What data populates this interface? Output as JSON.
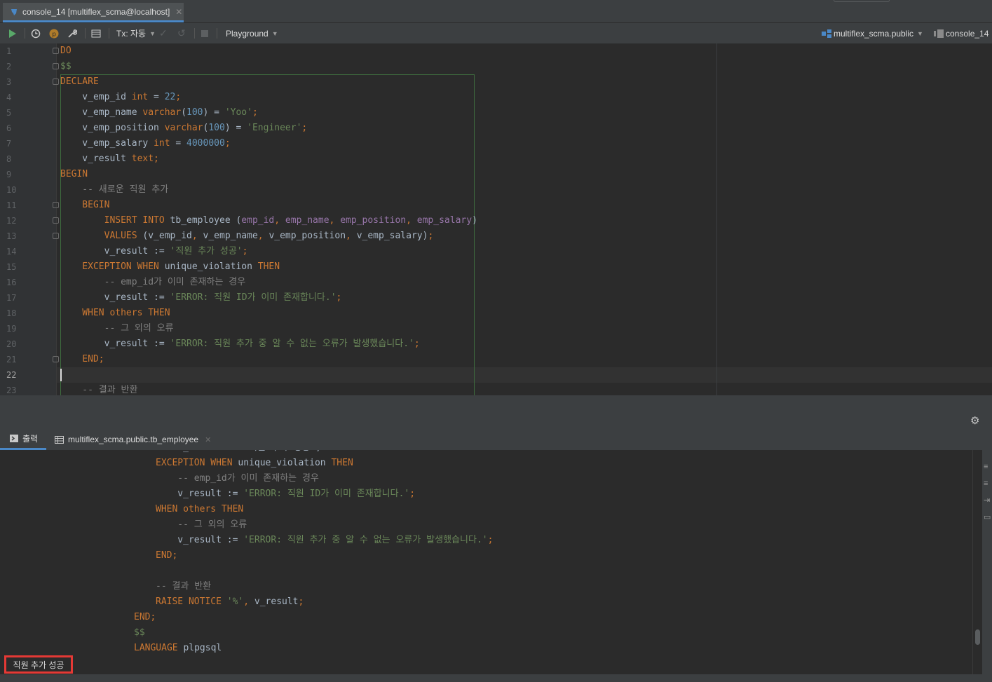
{
  "tab": {
    "title": "console_14 [multiflex_scma@localhost]"
  },
  "toolbar": {
    "tx_label": "Tx: 자동",
    "playground_label": "Playground",
    "schema_label": "multiflex_scma.public",
    "console_label": "console_14"
  },
  "editor": {
    "line_numbers": [
      "1",
      "2",
      "3",
      "4",
      "5",
      "6",
      "7",
      "8",
      "9",
      "10",
      "11",
      "12",
      "13",
      "14",
      "15",
      "16",
      "17",
      "18",
      "19",
      "20",
      "21",
      "22",
      "23"
    ],
    "current_line": "22",
    "lines": [
      [
        {
          "t": "DO",
          "c": "kw"
        }
      ],
      [
        {
          "t": "$$",
          "c": "str"
        }
      ],
      [
        {
          "t": "DECLARE",
          "c": "kw"
        }
      ],
      [
        {
          "t": "    v_emp_id ",
          "c": "id"
        },
        {
          "t": "int",
          "c": "kw"
        },
        {
          "t": " = ",
          "c": "id"
        },
        {
          "t": "22",
          "c": "num"
        },
        {
          "t": ";",
          "c": "kw"
        }
      ],
      [
        {
          "t": "    v_emp_name ",
          "c": "id"
        },
        {
          "t": "varchar",
          "c": "kw"
        },
        {
          "t": "(",
          "c": "id"
        },
        {
          "t": "100",
          "c": "num"
        },
        {
          "t": ") = ",
          "c": "id"
        },
        {
          "t": "'Yoo'",
          "c": "str"
        },
        {
          "t": ";",
          "c": "kw"
        }
      ],
      [
        {
          "t": "    v_emp_position ",
          "c": "id"
        },
        {
          "t": "varchar",
          "c": "kw"
        },
        {
          "t": "(",
          "c": "id"
        },
        {
          "t": "100",
          "c": "num"
        },
        {
          "t": ") = ",
          "c": "id"
        },
        {
          "t": "'Engineer'",
          "c": "str"
        },
        {
          "t": ";",
          "c": "kw"
        }
      ],
      [
        {
          "t": "    v_emp_salary ",
          "c": "id"
        },
        {
          "t": "int",
          "c": "kw"
        },
        {
          "t": " = ",
          "c": "id"
        },
        {
          "t": "4000000",
          "c": "num"
        },
        {
          "t": ";",
          "c": "kw"
        }
      ],
      [
        {
          "t": "    v_result ",
          "c": "id"
        },
        {
          "t": "text;",
          "c": "kw"
        }
      ],
      [
        {
          "t": "BEGIN",
          "c": "kw"
        }
      ],
      [
        {
          "t": "    -- 새로운 직원 추가",
          "c": "cmt"
        }
      ],
      [
        {
          "t": "    BEGIN",
          "c": "kw"
        }
      ],
      [
        {
          "t": "        INSERT INTO ",
          "c": "kw"
        },
        {
          "t": "tb_employee (",
          "c": "id"
        },
        {
          "t": "emp_id",
          "c": "col"
        },
        {
          "t": ", ",
          "c": "kw"
        },
        {
          "t": "emp_name",
          "c": "col"
        },
        {
          "t": ", ",
          "c": "kw"
        },
        {
          "t": "emp_position",
          "c": "col"
        },
        {
          "t": ", ",
          "c": "kw"
        },
        {
          "t": "emp_salary",
          "c": "col"
        },
        {
          "t": ")",
          "c": "id"
        }
      ],
      [
        {
          "t": "        VALUES ",
          "c": "kw"
        },
        {
          "t": "(v_emp_id",
          "c": "id"
        },
        {
          "t": ", ",
          "c": "kw"
        },
        {
          "t": "v_emp_name",
          "c": "id"
        },
        {
          "t": ", ",
          "c": "kw"
        },
        {
          "t": "v_emp_position",
          "c": "id"
        },
        {
          "t": ", ",
          "c": "kw"
        },
        {
          "t": "v_emp_salary)",
          "c": "id"
        },
        {
          "t": ";",
          "c": "kw"
        }
      ],
      [
        {
          "t": "        v_result := ",
          "c": "id"
        },
        {
          "t": "'직원 추가 성공'",
          "c": "str"
        },
        {
          "t": ";",
          "c": "kw"
        }
      ],
      [
        {
          "t": "    EXCEPTION WHEN ",
          "c": "kw"
        },
        {
          "t": "unique_violation ",
          "c": "id"
        },
        {
          "t": "THEN",
          "c": "kw"
        }
      ],
      [
        {
          "t": "        -- emp_id가 이미 존재하는 경우",
          "c": "cmt"
        }
      ],
      [
        {
          "t": "        v_result := ",
          "c": "id"
        },
        {
          "t": "'ERROR: 직원 ID가 이미 존재합니다.'",
          "c": "str"
        },
        {
          "t": ";",
          "c": "kw"
        }
      ],
      [
        {
          "t": "    WHEN others THEN",
          "c": "kw"
        }
      ],
      [
        {
          "t": "        -- 그 외의 오류",
          "c": "cmt"
        }
      ],
      [
        {
          "t": "        v_result := ",
          "c": "id"
        },
        {
          "t": "'ERROR: 직원 추가 중 알 수 없는 오류가 발생했습니다.'",
          "c": "str"
        },
        {
          "t": ";",
          "c": "kw"
        }
      ],
      [
        {
          "t": "    END;",
          "c": "kw"
        }
      ],
      [
        {
          "t": "",
          "c": "id"
        }
      ],
      [
        {
          "t": "    -- 결과 반환",
          "c": "cmt"
        }
      ]
    ]
  },
  "bottom_tabs": {
    "output_label": "출력",
    "table_label": "multiflex_scma.public.tb_employee"
  },
  "output": {
    "lines": [
      [
        {
          "t": "    v_result := '직원 추가 성공';",
          "c": "id"
        }
      ],
      [
        {
          "t": "EXCEPTION WHEN ",
          "c": "kw"
        },
        {
          "t": "unique_violation ",
          "c": "id"
        },
        {
          "t": "THEN",
          "c": "kw"
        }
      ],
      [
        {
          "t": "    -- emp_id가 이미 존재하는 경우",
          "c": "cmt"
        }
      ],
      [
        {
          "t": "    v_result := ",
          "c": "id"
        },
        {
          "t": "'ERROR: 직원 ID가 이미 존재합니다.'",
          "c": "str"
        },
        {
          "t": ";",
          "c": "kw"
        }
      ],
      [
        {
          "t": "WHEN others THEN",
          "c": "kw"
        }
      ],
      [
        {
          "t": "    -- 그 외의 오류",
          "c": "cmt"
        }
      ],
      [
        {
          "t": "    v_result := ",
          "c": "id"
        },
        {
          "t": "'ERROR: 직원 추가 중 알 수 없는 오류가 발생했습니다.'",
          "c": "str"
        },
        {
          "t": ";",
          "c": "kw"
        }
      ],
      [
        {
          "t": "END;",
          "c": "kw"
        }
      ],
      [
        {
          "t": "",
          "c": "id"
        }
      ],
      [
        {
          "t": "-- 결과 반환",
          "c": "cmt"
        }
      ],
      [
        {
          "t": "RAISE NOTICE ",
          "c": "kw"
        },
        {
          "t": "'%'",
          "c": "str"
        },
        {
          "t": ", ",
          "c": "kw"
        },
        {
          "t": "v_result",
          "c": "id"
        },
        {
          "t": ";",
          "c": "kw"
        }
      ]
    ],
    "tail_lines": [
      [
        {
          "t": "END;",
          "c": "kw"
        }
      ],
      [
        {
          "t": "$$",
          "c": "str"
        }
      ],
      [
        {
          "t": "LANGUAGE ",
          "c": "kw"
        },
        {
          "t": "plpgsql",
          "c": "id"
        }
      ]
    ],
    "result_text": "직원 추가 성공"
  },
  "colors": {
    "accent": "#4a88c7",
    "highlight_box": "#e53935",
    "run_green": "#59a869"
  }
}
